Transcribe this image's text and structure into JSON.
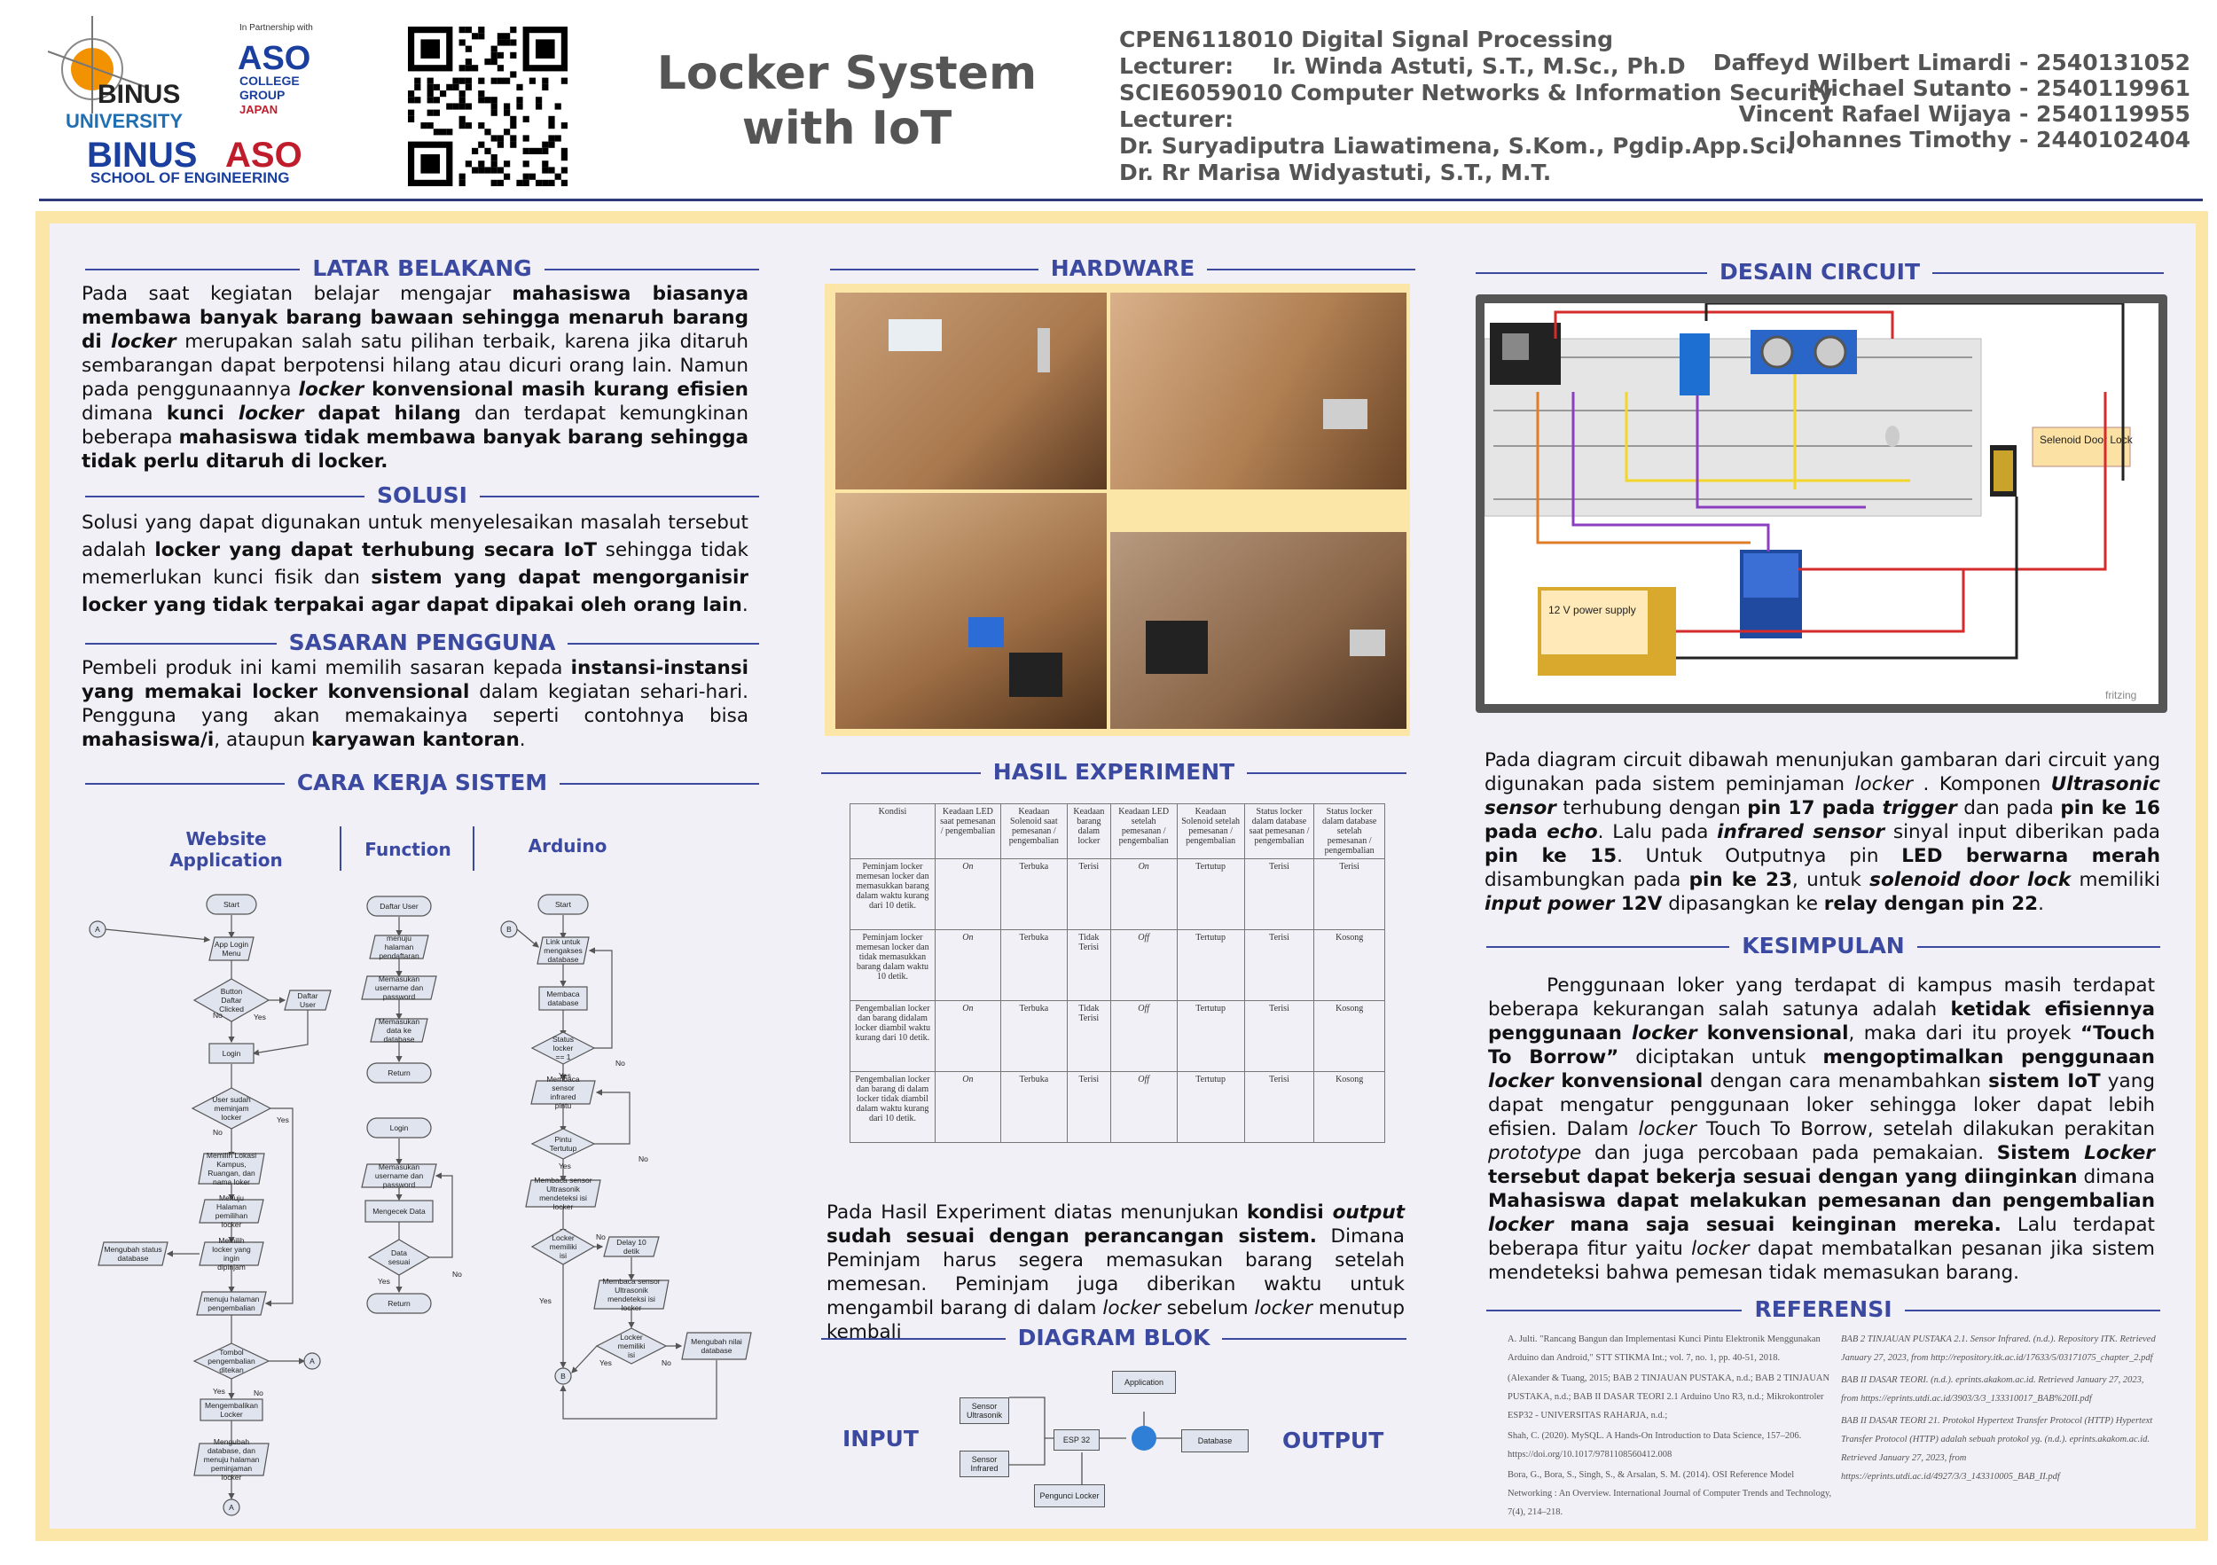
{
  "header": {
    "logo": {
      "university": "BINUS UNIVERSITY",
      "partner_caption": "In Partnership with",
      "partner": "ASO COLLEGE GROUP JAPAN",
      "school_line1": "BINUS ASO",
      "school_line2": "SCHOOL OF ENGINEERING"
    },
    "title": "Locker System with IoT",
    "course_lines": [
      "CPEN6118010 Digital Signal Processing",
      "Lecturer:     Ir. Winda Astuti, S.T., M.Sc., Ph.D",
      "SCIE6059010 Computer Networks & Information Security",
      "Lecturer:",
      "Dr. Suryadiputra Liawatimena, S.Kom., Pgdip.App.Sci.",
      "Dr. Rr Marisa Widyastuti, S.T., M.T."
    ],
    "authors": [
      "Daffeyd Wilbert Limardi - 2540131052",
      "Michael Sutanto - 2540119961",
      "Vincent Rafael Wijaya - 2540119955",
      "Johannes Timothy - 2440102404"
    ]
  },
  "sections": {
    "latar": {
      "title": "LATAR BELAKANG"
    },
    "solusi": {
      "title": "SOLUSI"
    },
    "sasaran": {
      "title": "SASARAN PENGGUNA"
    },
    "cara": {
      "title": "CARA KERJA SISTEM",
      "col1": "Website Application",
      "col2": "Function",
      "col3": "Arduino"
    },
    "hardware": {
      "title": "HARDWARE"
    },
    "hasil": {
      "title": "HASIL EXPERIMENT"
    },
    "diagram": {
      "title": "DIAGRAM BLOK",
      "input": "INPUT",
      "output": "OUTPUT",
      "nodes": [
        "Sensor Ultrasonik",
        "Sensor Infrared",
        "ESP 32",
        "Application",
        "Database",
        "Pengunci Locker"
      ]
    },
    "desain": {
      "title": "DESAIN CIRCUIT",
      "label_solenoid": "Selenoid Door Lock",
      "label_power": "12 V power supply",
      "brand": "fritzing"
    },
    "kesimpulan": {
      "title": "KESIMPULAN"
    },
    "referensi": {
      "title": "REFERENSI"
    }
  },
  "table": {
    "headers": [
      "Kondisi",
      "Keadaan LED saat pemesanan / pengembalian",
      "Keadaan Solenoid saat pemesanan / pengembalian",
      "Keadaan barang dalam locker",
      "Keadaan LED setelah pemesanan / pengembalian",
      "Keadaan Solenoid setelah pemesanan / pengembalian",
      "Status locker dalam database saat pemesanan / pengembalian",
      "Status locker dalam database setelah pemesanan / pengembalian"
    ],
    "rows": [
      [
        "Peminjam locker memesan locker dan memasukkan barang dalam waktu kurang dari 10 detik.",
        "On",
        "Terbuka",
        "Terisi",
        "On",
        "Tertutup",
        "Terisi",
        "Terisi"
      ],
      [
        "Peminjam locker memesan locker dan tidak memasukkan barang dalam waktu 10 detik.",
        "On",
        "Terbuka",
        "Tidak Terisi",
        "Off",
        "Tertutup",
        "Terisi",
        "Kosong"
      ],
      [
        "Pengembalian locker dan barang didalam locker diambil waktu kurang dari 10 detik.",
        "On",
        "Terbuka",
        "Tidak Terisi",
        "Off",
        "Tertutup",
        "Terisi",
        "Kosong"
      ],
      [
        "Pengembalian locker dan barang di dalam locker tidak diambil dalam waktu kurang dari 10 detik.",
        "On",
        "Terbuka",
        "Terisi",
        "Off",
        "Tertutup",
        "Terisi",
        "Kosong"
      ]
    ]
  },
  "flow": {
    "web": [
      "Start",
      "App Login Menu",
      "Button Daftar Clicked",
      "Daftar User",
      "Login",
      "User sudah meminjam locker",
      "Memilih Lokasi Kampus, Ruangan, dan nama loker",
      "Menuju Halaman pemilihan locker",
      "Memilih locker yang ingin dipinjam",
      "Mengubah status database",
      "menuju halaman pengembalian",
      "Tombol pengembalian ditekan",
      "Mengembalikan Locker",
      "Mengubah database, dan menuju halaman peminjaman locker"
    ],
    "func": [
      "Daftar User",
      "menuju halaman pendaftaran",
      "Memasukan username dan password",
      "Memasukan data ke database",
      "Return",
      "Login",
      "Memasukan username dan password",
      "Mengecek Data",
      "Data sesuai",
      "Return"
    ],
    "ard": [
      "Start",
      "Link untuk mengakses database",
      "Membaca database",
      "Status locker == 1",
      "Membaca sensor infrared pintu",
      "Pintu Tertutup",
      "Membaca sensor Ultrasonik mendeteksi isi locker",
      "Locker memiliki isi",
      "Delay 10 detik",
      "Membaca sensor Ultrasonik mendeteksi isi locker",
      "Locker memiliki isi",
      "Mengubah nilai database"
    ],
    "labels": {
      "yes": "Yes",
      "no": "No",
      "a": "A",
      "b": "B"
    }
  },
  "references": {
    "left": [
      "A. Julti. \"Rancang Bangun dan Implementasi Kunci Pintu Elektronik Menggunakan Arduino dan Android,\" STT STIKMA Int.; vol. 7, no. 1, pp. 40-51, 2018.",
      "(Alexander & Tuang, 2015; BAB 2 TINJAUAN PUSTAKA, n.d.; BAB 2 TINJAUAN PUSTAKA, n.d.; BAB II DASAR TEORI 2.1 Arduino Uno R3, n.d.; Mikrokontroler ESP32 - UNIVERSITAS RAHARJA, n.d.;",
      "Shah, C. (2020). MySQL. A Hands-On Introduction to Data Science, 157–206. https://doi.org/10.1017/9781108560412.008",
      "Bora, G., Bora, S., Singh, S., & Arsalan, S. M. (2014). OSI Reference Model Networking : An Overview. International Journal of Computer Trends and Technology, 7(4), 214–218."
    ],
    "right": [
      "BAB 2 TINJAUAN PUSTAKA 2.1. Sensor Infrared. (n.d.). Repository ITK. Retrieved January 27, 2023, from http://repository.itk.ac.id/17633/5/03171075_chapter_2.pdf",
      "BAB II DASAR TEORI. (n.d.). eprints.akakom.ac.id. Retrieved January 27, 2023, from https://eprints.utdi.ac.id/3903/3/3_133310017_BAB%20II.pdf",
      "BAB II DASAR TEORI 21. Protokol Hypertext Transfer Protocol (HTTP) Hypertext Transfer Protocol (HTTP) adalah sebuah protokol yg. (n.d.). eprints.akakom.ac.id. Retrieved January 27, 2023, from https://eprints.utdi.ac.id/4927/3/3_143310005_BAB_II.pdf"
    ]
  },
  "colors": {
    "accent": "#3b4aa0",
    "frame": "#fbe6a7",
    "panel": "#f0f0f6",
    "title_gray": "#555555"
  }
}
